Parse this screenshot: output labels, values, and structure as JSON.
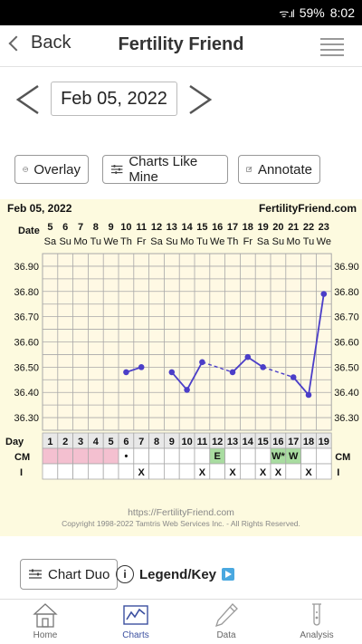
{
  "status": {
    "battery": "59%",
    "time": "8:02",
    "signal": "ᯤ.ıl"
  },
  "appbar": {
    "back_label": "Back",
    "title": "Fertility Friend"
  },
  "date_nav": {
    "current_date": "Feb 05, 2022"
  },
  "tools": {
    "overlay": "Overlay",
    "charts_like_mine": "Charts Like Mine",
    "annotate": "Annotate"
  },
  "footer": {
    "chart_duo": "Chart Duo",
    "legend_key": "Legend/Key",
    "info": "i"
  },
  "tabs": [
    {
      "label": "Home",
      "icon": "home-icon"
    },
    {
      "label": "Charts",
      "icon": "chart-icon"
    },
    {
      "label": "Data",
      "icon": "pencil-icon"
    },
    {
      "label": "Analysis",
      "icon": "test-tube-icon"
    }
  ],
  "colors": {
    "line": "#4b3ec8",
    "grid": "#a8a8a8",
    "chart_bg": "#fdfadf",
    "grid_bg": "#fff9e4",
    "pink": "#f4c0d0",
    "green": "#a8dca0",
    "accent": "#3b4fa0"
  },
  "chart_data": {
    "type": "line",
    "title": "Feb 05, 2022",
    "brand": "FertilityFriend.com",
    "date_label": "Date",
    "dates": [
      "5",
      "6",
      "7",
      "8",
      "9",
      "10",
      "11",
      "12",
      "13",
      "14",
      "15",
      "16",
      "17",
      "18",
      "19",
      "20",
      "21",
      "22",
      "23"
    ],
    "weekdays": [
      "Sa",
      "Su",
      "Mo",
      "Tu",
      "We",
      "Th",
      "Fr",
      "Sa",
      "Su",
      "Mo",
      "Tu",
      "We",
      "Th",
      "Fr",
      "Sa",
      "Su",
      "Mo",
      "Tu",
      "We"
    ],
    "day_label": "Day",
    "days": [
      "1",
      "2",
      "3",
      "4",
      "5",
      "6",
      "7",
      "8",
      "9",
      "10",
      "11",
      "12",
      "13",
      "14",
      "15",
      "16",
      "17",
      "18",
      "19"
    ],
    "ylim": [
      36.25,
      36.95
    ],
    "y_ticks": [
      "36.90",
      "36.80",
      "36.70",
      "36.60",
      "36.50",
      "36.40",
      "36.30"
    ],
    "temps": [
      null,
      null,
      null,
      null,
      null,
      36.48,
      36.5,
      null,
      36.48,
      36.41,
      36.52,
      null,
      36.48,
      36.54,
      36.5,
      null,
      36.46,
      36.39,
      36.79
    ],
    "dashed_segments": [
      [
        10,
        12
      ],
      [
        14,
        16
      ]
    ],
    "cm_label": "CM",
    "cm": [
      "",
      "",
      "",
      "",
      "",
      "•",
      "",
      "",
      "",
      "",
      "",
      "E",
      "",
      "",
      "",
      "W*",
      "W",
      "",
      ""
    ],
    "cm_colors": [
      "pink",
      "pink",
      "pink",
      "pink",
      "pink",
      "",
      "",
      "",
      "",
      "",
      "",
      "green",
      "",
      "",
      "",
      "green",
      "green",
      "",
      ""
    ],
    "i_label": "I",
    "intercourse": [
      "",
      "",
      "",
      "",
      "",
      "",
      "X",
      "",
      "",
      "",
      "X",
      "",
      "X",
      "",
      "X",
      "X",
      "",
      "X",
      ""
    ],
    "url": "https://FertilityFriend.com",
    "copyright": "Copyright 1998-2022 Tamtris Web Services Inc. - All Rights Reserved."
  }
}
